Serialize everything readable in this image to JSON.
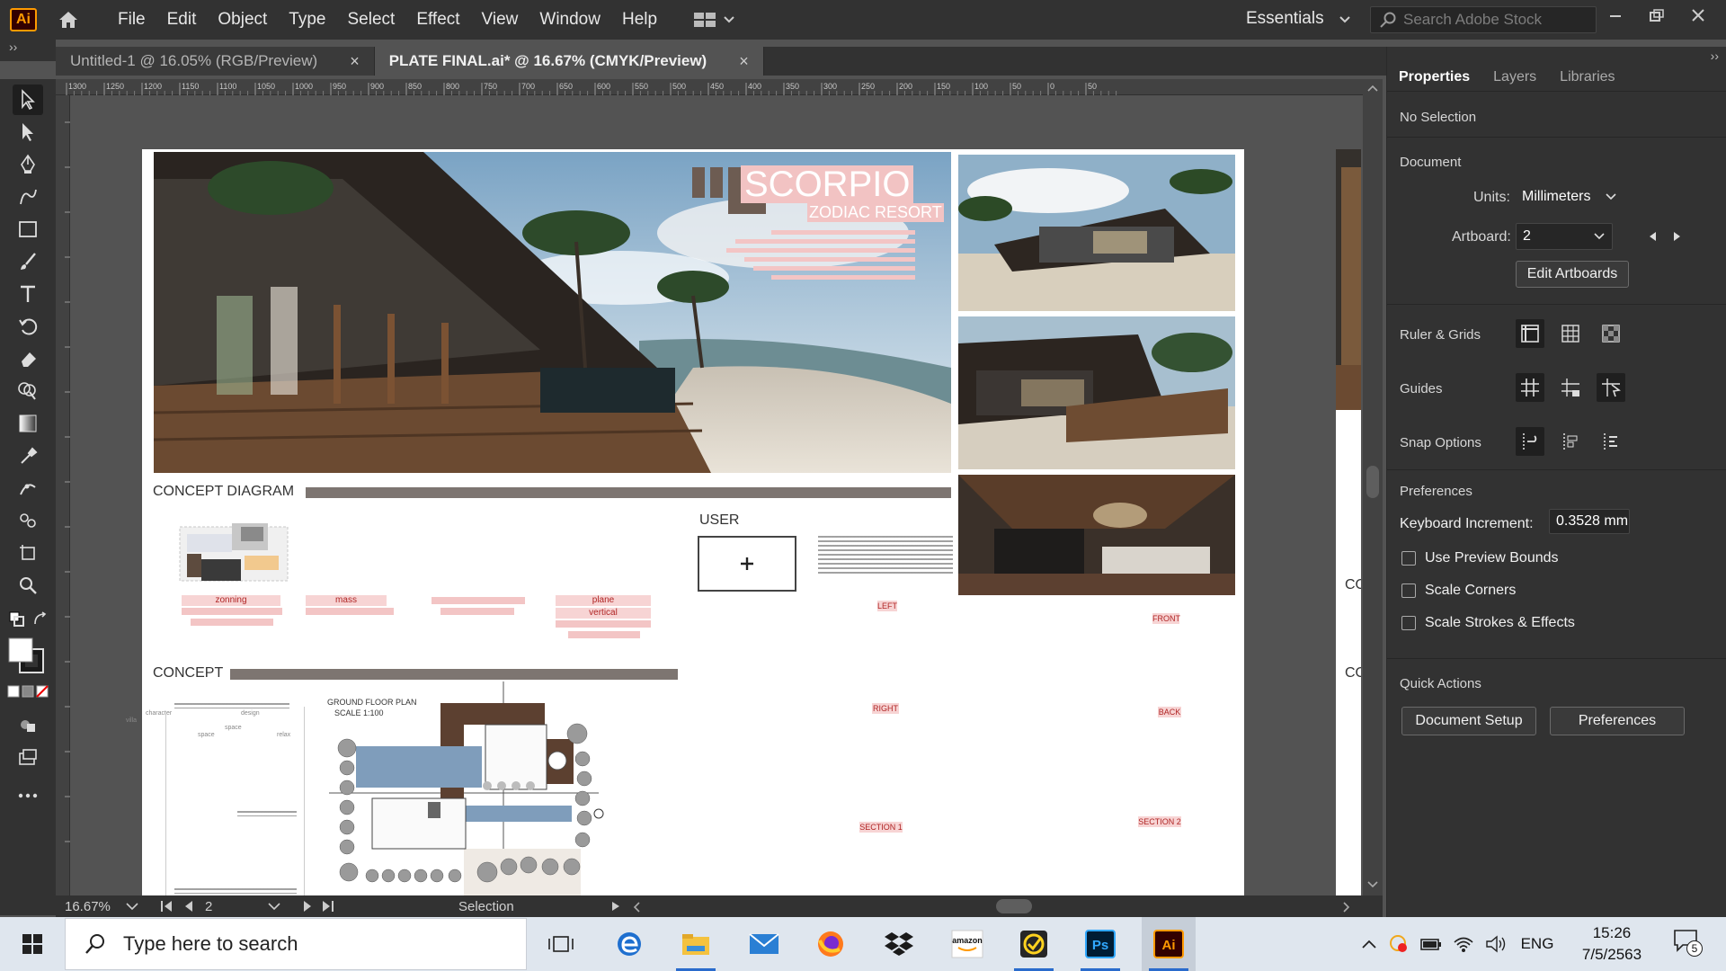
{
  "app": {
    "logo": "Ai"
  },
  "menu": [
    "File",
    "Edit",
    "Object",
    "Type",
    "Select",
    "Effect",
    "View",
    "Window",
    "Help"
  ],
  "workspace": {
    "name": "Essentials"
  },
  "stock_search": {
    "placeholder": "Search Adobe Stock"
  },
  "tabs": [
    {
      "label": "Untitled-1 @ 16.05% (RGB/Preview)",
      "close": "×"
    },
    {
      "label": "PLATE FINAL.ai* @ 16.67% (CMYK/Preview)",
      "close": "×"
    }
  ],
  "ruler_ticks": [
    "1300",
    "1250",
    "1200",
    "1150",
    "1100",
    "1050",
    "1000",
    "950",
    "900",
    "850",
    "800",
    "750",
    "700",
    "650",
    "600",
    "550",
    "500",
    "450",
    "400",
    "350",
    "300",
    "250",
    "200",
    "150",
    "100",
    "50",
    "0",
    "50"
  ],
  "artboard": {
    "title": "SCORPIO",
    "subtitle": "ZODIAC RESORT",
    "concept_diagram": "CONCEPT DIAGRAM",
    "concept": "CONCEPT",
    "user": "USER",
    "plan_title": "GROUND FLOOR PLAN",
    "plan_scale": "SCALE 1:100",
    "views": {
      "left": "LEFT",
      "front": "FRONT",
      "right": "RIGHT",
      "back": "BACK",
      "section1": "SECTION 1",
      "section2": "SECTION 2"
    },
    "diagram_notes": [
      "zonning",
      "mass",
      "plane",
      "vertical"
    ],
    "concept_notes": [
      "character",
      "design",
      "villa",
      "space",
      "space",
      "relax"
    ]
  },
  "second_artboard": {
    "concept_a": "CONCEPT",
    "concept_b": "CONCEPT"
  },
  "status": {
    "zoom": "16.67%",
    "artboard_number": "2",
    "tool": "Selection"
  },
  "panel": {
    "tabs": [
      "Properties",
      "Layers",
      "Libraries"
    ],
    "selection": "No Selection",
    "document_label": "Document",
    "units_label": "Units:",
    "units_value": "Millimeters",
    "artboard_label": "Artboard:",
    "artboard_value": "2",
    "edit_artboards": "Edit Artboards",
    "ruler_grids": "Ruler & Grids",
    "guides": "Guides",
    "snap_options": "Snap Options",
    "preferences_label": "Preferences",
    "keyboard_increment_label": "Keyboard Increment:",
    "keyboard_increment_value": "0.3528 mm",
    "checkboxes": [
      "Use Preview Bounds",
      "Scale Corners",
      "Scale Strokes & Effects"
    ],
    "quick_actions": "Quick Actions",
    "document_setup": "Document Setup",
    "preferences_button": "Preferences"
  },
  "taskbar": {
    "search_placeholder": "Type here to search",
    "language": "ENG",
    "time": "15:26",
    "date": "7/5/2563",
    "notification_count": "5",
    "amazon_label": "amazon"
  },
  "colors": {
    "accent": "#ff9a00",
    "panel_bg": "#323232",
    "canvas_bg": "#535353",
    "title_pink": "#f4c9c9"
  }
}
